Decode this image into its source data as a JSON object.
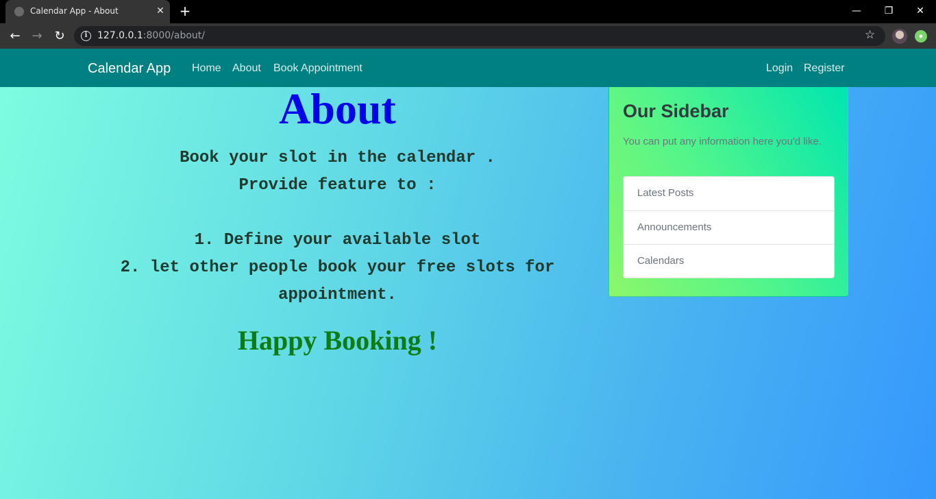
{
  "browser": {
    "tab_title": "Calendar App - About",
    "tab_close": "✕",
    "new_tab": "+",
    "url_host": "127.0.0.1",
    "url_rest": ":8000/about/",
    "window_controls": [
      "—",
      "❐",
      "✕"
    ]
  },
  "navbar": {
    "brand": "Calendar App",
    "links": [
      "Home",
      "About",
      "Book Appointment"
    ],
    "right_links": [
      "Login",
      "Register"
    ],
    "color": "#008080"
  },
  "main": {
    "title": "About",
    "lines": [
      "Book your slot in the calendar .",
      "Provide feature to :",
      "",
      "1. Define your available slot",
      "2. let other people book your free slots for",
      "appointment."
    ],
    "closing": "Happy Booking !"
  },
  "sidebar": {
    "title": "Our Sidebar",
    "text": "You can put any information here you'd like.",
    "items": [
      "Latest Posts",
      "Announcements",
      "Calendars"
    ]
  }
}
